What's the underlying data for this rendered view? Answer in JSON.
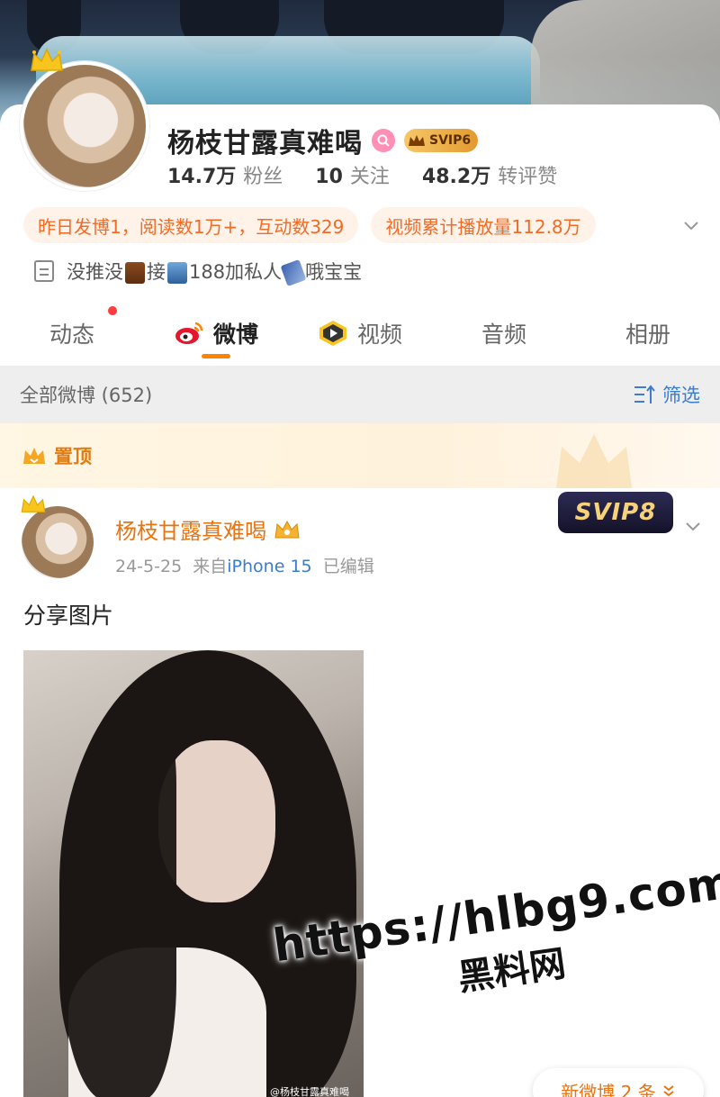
{
  "profile": {
    "name": "杨枝甘露真难喝",
    "vip_badge": "SVIP6",
    "stats": [
      {
        "num": "14.7万",
        "label": "粉丝"
      },
      {
        "num": "10",
        "label": "关注"
      },
      {
        "num": "48.2万",
        "label": "转评赞"
      }
    ],
    "tags": [
      "昨日发博1，阅读数1万+，互动数329",
      "视频累计播放量112.8万"
    ],
    "bio_part1": "没推没",
    "bio_part2": "接",
    "bio_part3": "188加私人",
    "bio_part4": "哦宝宝"
  },
  "tabs": [
    {
      "label": "动态"
    },
    {
      "label": "微博"
    },
    {
      "label": "视频"
    },
    {
      "label": "音频"
    },
    {
      "label": "相册"
    }
  ],
  "filter": {
    "label": "全部微博 (652)",
    "button": "筛选"
  },
  "pinned": {
    "label": "置顶"
  },
  "post": {
    "author": "杨枝甘露真难喝",
    "date": "24-5-25",
    "from": "来自",
    "source": "iPhone 15",
    "edited": "已编辑",
    "text": "分享图片",
    "svip_badge": "SVIP8",
    "image_watermark": "@杨枝甘露真难喝"
  },
  "watermark": {
    "url": "https://hlbg9.com",
    "sub": "黑料网"
  },
  "new_posts": "新微博 2 条",
  "colors": {
    "accent": "#ff8200",
    "link": "#3b7bd0",
    "tag_text": "#f26b25",
    "name_orange": "#e8730f"
  }
}
